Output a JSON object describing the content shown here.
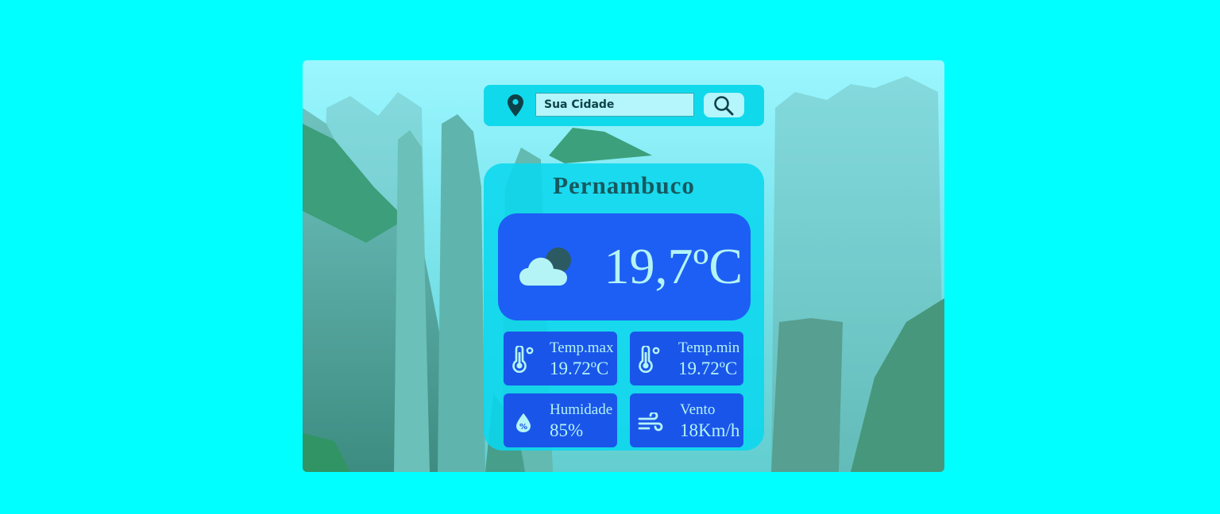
{
  "search": {
    "placeholder": "Sua Cidade",
    "value": ""
  },
  "weather": {
    "city": "Pernambuco",
    "temperature": "19,7ºC",
    "icon": "cloud-night-icon"
  },
  "details": {
    "temp_max": {
      "label": "Temp.max",
      "value": "19.72ºC",
      "icon": "thermometer-icon"
    },
    "temp_min": {
      "label": "Temp.min",
      "value": "19.72ºC",
      "icon": "thermometer-icon"
    },
    "humidity": {
      "label": "Humidade",
      "value": "85%",
      "icon": "humidity-drop-icon"
    },
    "wind": {
      "label": "Vento",
      "value": "18Km/h",
      "icon": "wind-icon"
    }
  },
  "colors": {
    "page_background": "#00ffff",
    "search_bar": "#11d9ec",
    "card": "#0ad7ee",
    "panel": "#1d5ff4",
    "text_light": "#b4f4f6",
    "text_dark": "#16595f"
  }
}
